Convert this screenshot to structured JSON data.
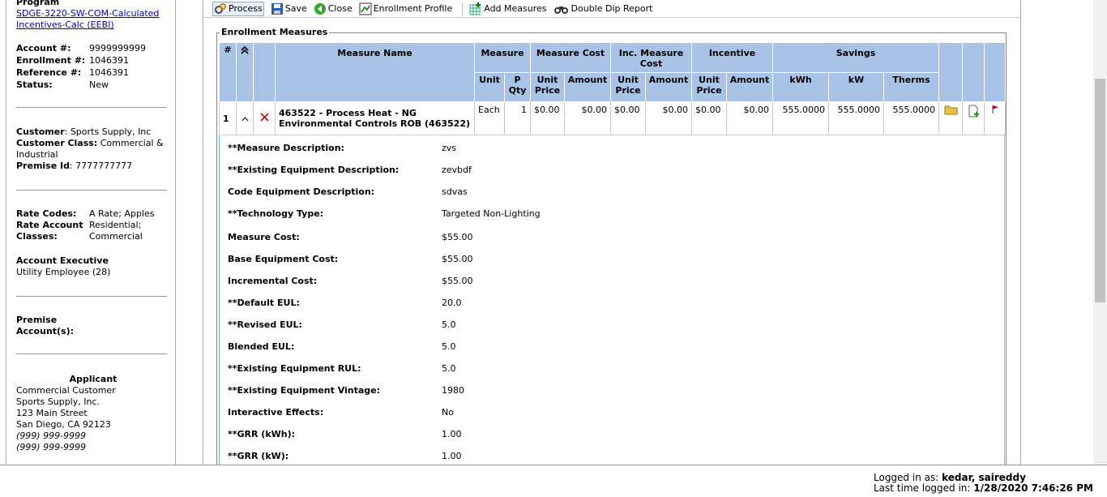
{
  "sidebar": {
    "program_label": "Program",
    "program_link": "SDGE-3220-SW-COM-Calculated Incentives-Calc (EEBI)",
    "account_label": "Account #:",
    "account_value": "9999999999",
    "enrollment_label": "Enrollment #:",
    "enrollment_value": "1046391",
    "reference_label": "Reference #:",
    "reference_value": "1046391",
    "status_label": "Status:",
    "status_value": "New",
    "customer_label": "Customer",
    "customer_value": ": Sports Supply, Inc",
    "customer_class_label": "Customer Class:",
    "customer_class_value": "Commercial & Industrial",
    "premise_label": "Premise Id",
    "premise_value": ": 7777777777",
    "rate_codes_label": "Rate Codes:",
    "rate_codes_value": "A Rate; Apples",
    "rate_account_label": "Rate Account Classes:",
    "rate_account_value": "Residential; Commercial",
    "acct_exec_label": "Account Executive",
    "acct_exec_value": "Utility Employee (28)",
    "premise_accounts_label": "Premise Account(s):",
    "applicant_label": "Applicant",
    "applicant_lines": [
      "Commercial Customer",
      "Sports Supply, Inc.",
      "123 Main Street",
      "San Diego, CA 92123",
      "(999) 999-9999",
      "(999) 999-9999"
    ]
  },
  "toolbar": {
    "process": "Process",
    "save": "Save",
    "close": "Close",
    "enrollment_profile": "Enrollment Profile",
    "add_measures": "Add Measures",
    "double_dip": "Double Dip Report"
  },
  "section_title": "Enrollment Measures",
  "table": {
    "h_num": "#",
    "h_measure_name": "Measure Name",
    "h_measure": "Measure",
    "h_measure_cost": "Measure Cost",
    "h_inc_measure_cost": "Inc. Measure Cost",
    "h_incentive": "Incentive",
    "h_savings": "Savings",
    "h_unit": "Unit",
    "h_pqty": "P Qty",
    "h_unit_price": "Unit Price",
    "h_amount": "Amount",
    "h_kwh": "kWh",
    "h_kw": "kW",
    "h_therms": "Therms",
    "row": {
      "num": "1",
      "name": "463522 - Process Heat - NG Environmental Controls ROB (463522)",
      "unit": "Each",
      "pqty": "1",
      "mc_unit_price": "$0.00",
      "mc_amount": "$0.00",
      "imc_unit_price": "$0.00",
      "imc_amount": "$0.00",
      "inc_unit_price": "$0.00",
      "inc_amount": "$0.00",
      "kwh": "555.0000",
      "kw": "555.0000",
      "therms": "555.0000"
    }
  },
  "details": [
    {
      "k": "**Measure Description:",
      "v": "zvs"
    },
    {
      "k": "**Existing Equipment Description:",
      "v": "zevbdf"
    },
    {
      "k": "Code Equipment Description:",
      "v": "sdvas"
    },
    {
      "k": "**Technology Type:",
      "v": "Targeted Non-Lighting"
    },
    {
      "k": "Measure Cost:",
      "v": "$55.00"
    },
    {
      "k": "Base Equipment Cost:",
      "v": "$55.00"
    },
    {
      "k": "Incremental Cost:",
      "v": "$55.00"
    },
    {
      "k": "**Default EUL:",
      "v": "20.0"
    },
    {
      "k": "**Revised EUL:",
      "v": "5.0"
    },
    {
      "k": "Blended EUL:",
      "v": "5.0"
    },
    {
      "k": "**Existing Equipment RUL:",
      "v": "5.0"
    },
    {
      "k": "**Existing Equipment Vintage:",
      "v": "1980"
    },
    {
      "k": "Interactive Effects:",
      "v": "No"
    },
    {
      "k": "**GRR (kWh):",
      "v": "1.00"
    },
    {
      "k": "**GRR (kW):",
      "v": "1.00"
    }
  ],
  "status": {
    "logged_in_label": "Logged in as:",
    "logged_in_value": "kedar, saireddy",
    "last_time_label": "Last time logged in:",
    "last_time_value": "1/28/2020 7:46:26 PM"
  }
}
